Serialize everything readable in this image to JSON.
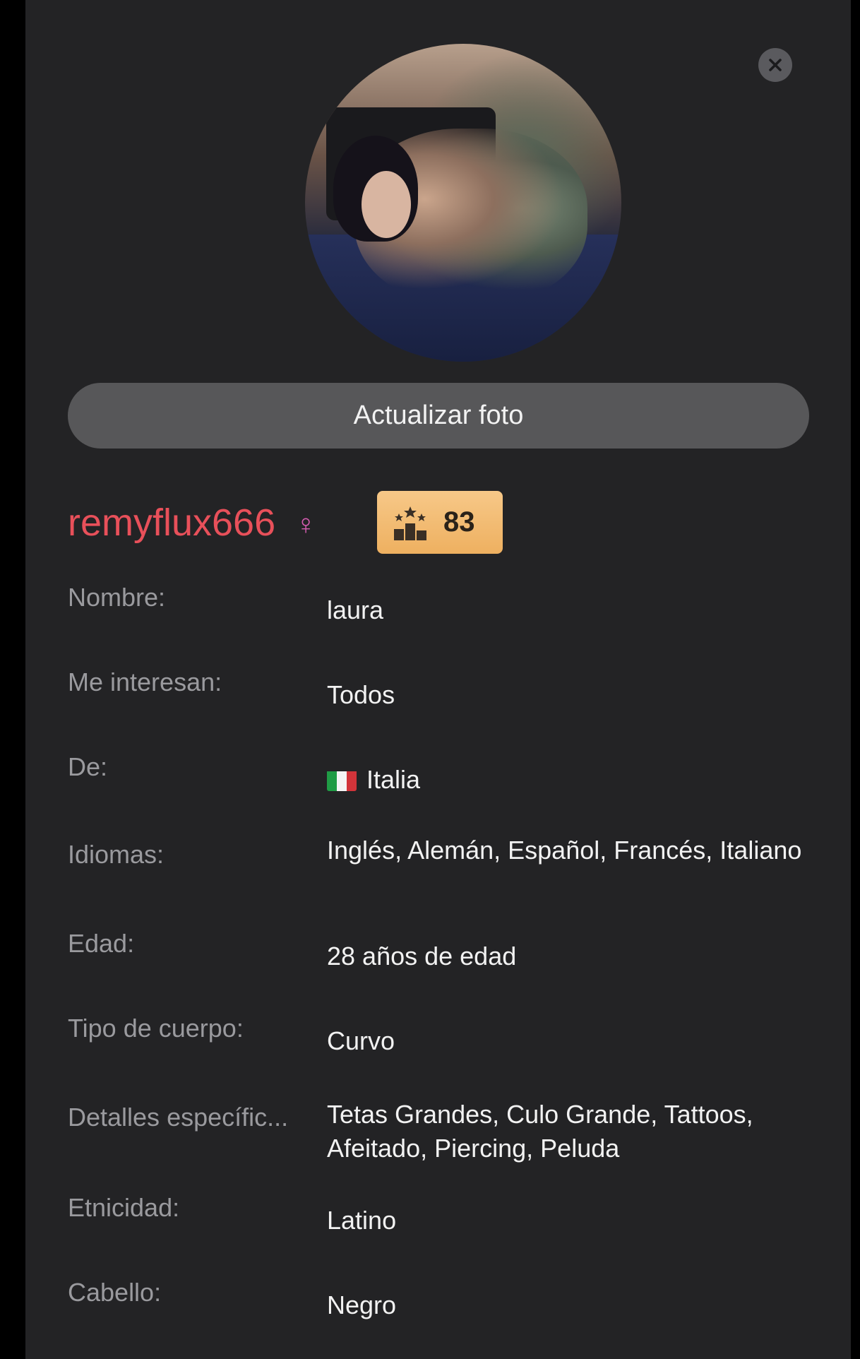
{
  "profile": {
    "update_photo_label": "Actualizar foto",
    "username": "remyflux666",
    "gender_symbol": "♀",
    "rank_value": "83",
    "colors": {
      "username": "#e8505a",
      "gender": "#d45cb0",
      "badge": "#f4bd78"
    }
  },
  "details": [
    {
      "label": "Nombre:",
      "value": "laura"
    },
    {
      "label": "Me interesan:",
      "value": "Todos"
    },
    {
      "label": "De:",
      "value": "Italia",
      "flag": "italy-flag-icon"
    },
    {
      "label": "Idiomas:",
      "value": "Inglés, Alemán, Español, Francés, Italiano"
    },
    {
      "label": "Edad:",
      "value": "28 años de edad"
    },
    {
      "label": "Tipo de cuerpo:",
      "value": "Curvo"
    },
    {
      "label": "Detalles específic...",
      "value": "Tetas Grandes, Culo Grande, Tattoos, Afeitado, Piercing, Peluda"
    },
    {
      "label": "Etnicidad:",
      "value": "Latino"
    },
    {
      "label": "Cabello:",
      "value": "Negro"
    }
  ]
}
